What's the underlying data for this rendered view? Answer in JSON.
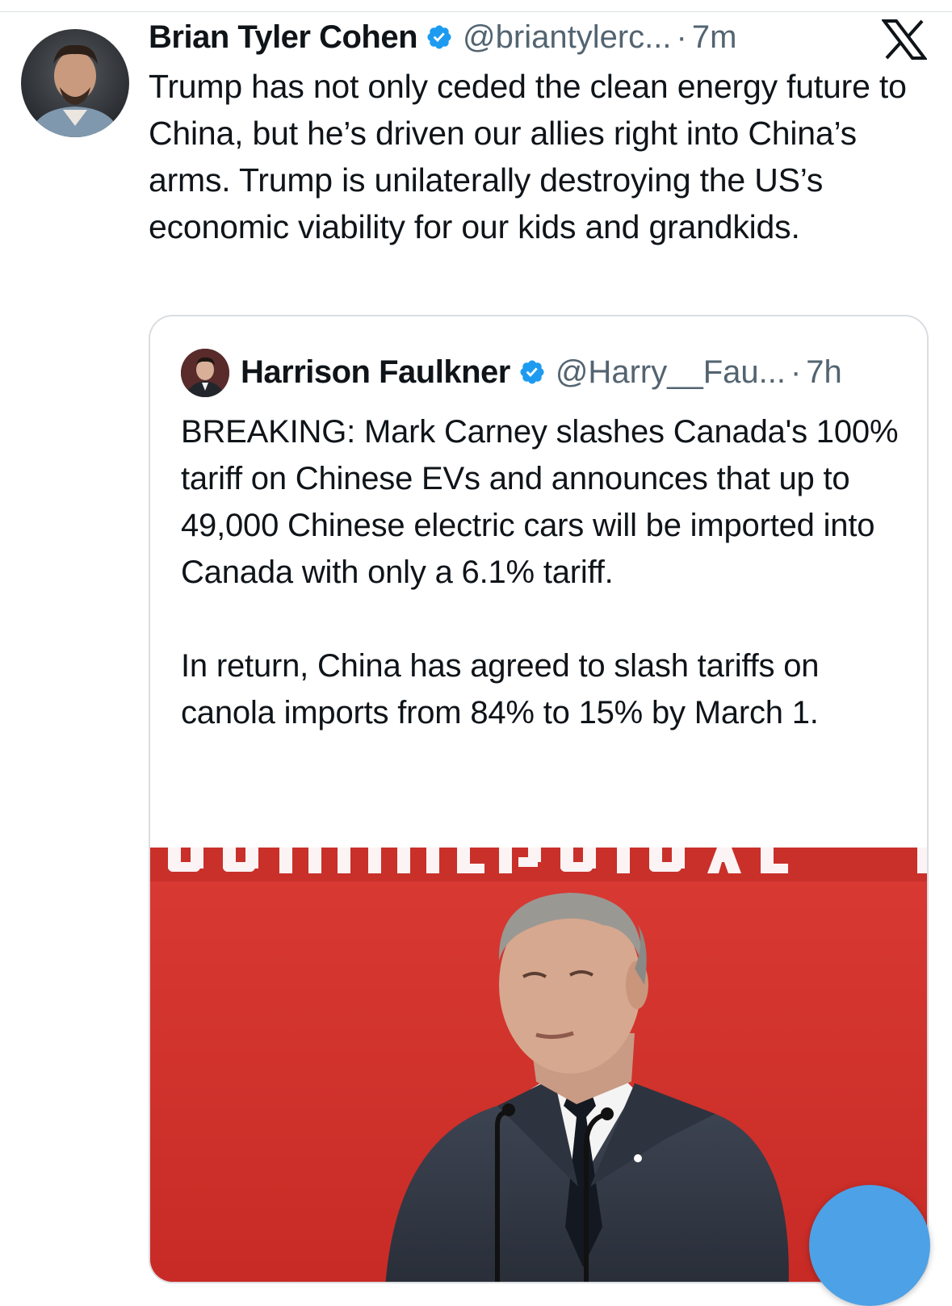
{
  "tweet": {
    "author_name": "Brian Tyler Cohen",
    "handle": "@briantylerc...",
    "separator": "·",
    "age": "7m",
    "text": "Trump has not only ceded the clean energy future to China, but he’s driven our allies right into China’s arms. Trump is unilaterally destroying the US’s economic viability for our kids and grandkids."
  },
  "quoted_tweet": {
    "author_name": "Harrison Faulkner",
    "handle": "@Harry__Fau...",
    "separator": "·",
    "age": "7h",
    "text": "BREAKING: Mark Carney slashes Canada's 100% tariff on Chinese EVs and announces that up to 49,000 Chinese electric cars will be imported into Canada with only a 6.1% tariff.\n\nIn return, China has agreed to slash tariffs on canola imports from 84% to 15% by March 1."
  },
  "media": {
    "backdrop_text": "COMMERCIAL",
    "backdrop_color": "#d8352f"
  },
  "colors": {
    "verified_badge": "#1d9bf0",
    "secondary_text": "#536471",
    "fab": "#4da1e6"
  },
  "icons": {
    "verified": "verified-badge-icon",
    "platform": "x-logo-icon"
  }
}
